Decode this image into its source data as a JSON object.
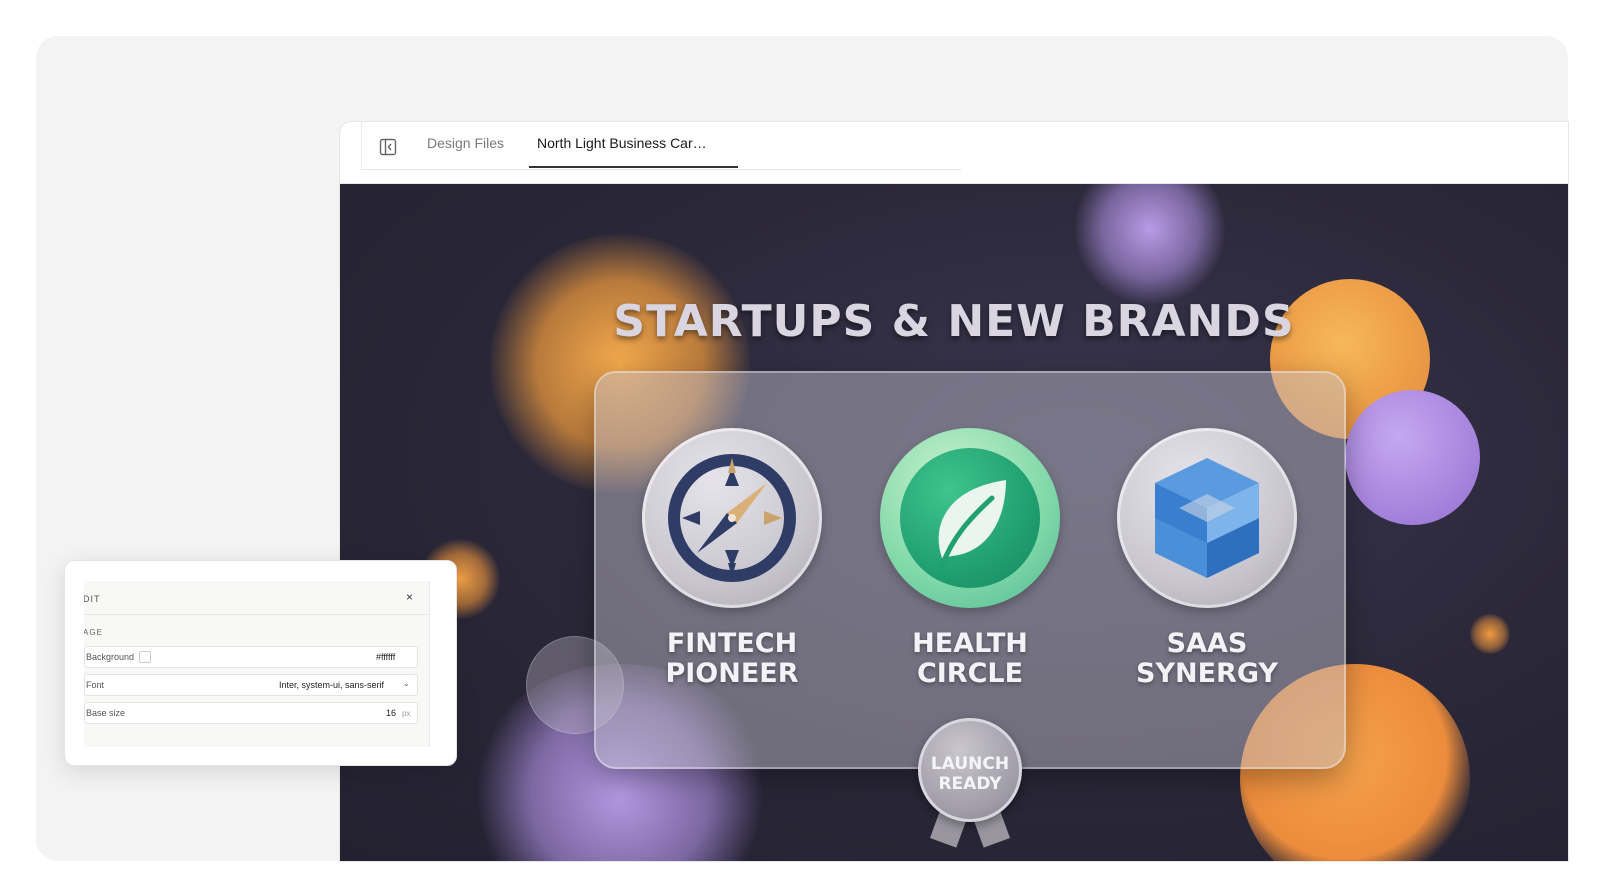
{
  "tabs": {
    "design_files": "Design Files",
    "active_tab": "North Light Business Car…"
  },
  "canvas": {
    "headline": "STARTUPS & NEW BRANDS",
    "brands": [
      {
        "line1": "FINTECH",
        "line2": "PIONEER",
        "icon": "compass-icon"
      },
      {
        "line1": "HEALTH",
        "line2": "CIRCLE",
        "icon": "leaf-icon"
      },
      {
        "line1": "SAAS",
        "line2": "SYNERGY",
        "icon": "cube-logo-icon"
      }
    ],
    "seal": {
      "line1": "LAUNCH",
      "line2": "READY"
    },
    "colors": {
      "orange": "#f2a24a",
      "purple": "#a98ad6",
      "background": "#2a2738"
    }
  },
  "panel": {
    "title": "DIT",
    "section": "AGE",
    "close_glyph": "×",
    "background_label": "Background",
    "background_value": "#ffffff",
    "font_label": "Font",
    "font_value": "Inter, system-ui, sans-serif",
    "base_size_label": "Base size",
    "base_size_value": "16",
    "base_size_unit": "px"
  }
}
